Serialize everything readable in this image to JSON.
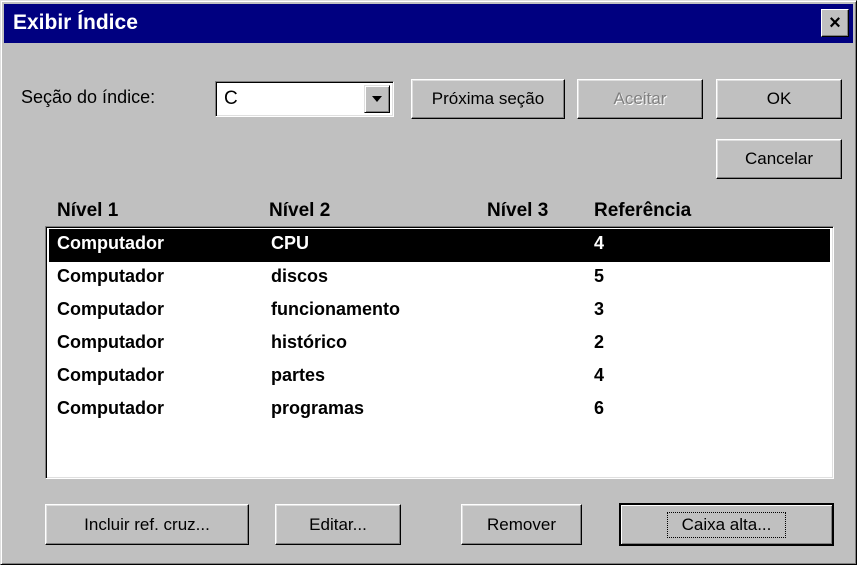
{
  "window": {
    "title": "Exibir Índice",
    "close_symbol": "×"
  },
  "section": {
    "label": "Seção do índice:",
    "value": "C"
  },
  "buttons": {
    "next_section": "Próxima seção",
    "accept": "Aceitar",
    "ok": "OK",
    "cancel": "Cancelar",
    "include_cross_ref": "Incluir ref. cruz...",
    "edit": "Editar...",
    "remove": "Remover",
    "uppercase": "Caixa alta..."
  },
  "table": {
    "headers": [
      "Nível 1",
      "Nível 2",
      "Nível 3",
      "Referência"
    ],
    "rows": [
      [
        "Computador",
        "CPU",
        "",
        "4"
      ],
      [
        "Computador",
        "discos",
        "",
        "5"
      ],
      [
        "Computador",
        "funcionamento",
        "",
        "3"
      ],
      [
        "Computador",
        "histórico",
        "",
        "2"
      ],
      [
        "Computador",
        "partes",
        "",
        "4"
      ],
      [
        "Computador",
        "programas",
        "",
        "6"
      ]
    ],
    "selected_index": 0
  }
}
